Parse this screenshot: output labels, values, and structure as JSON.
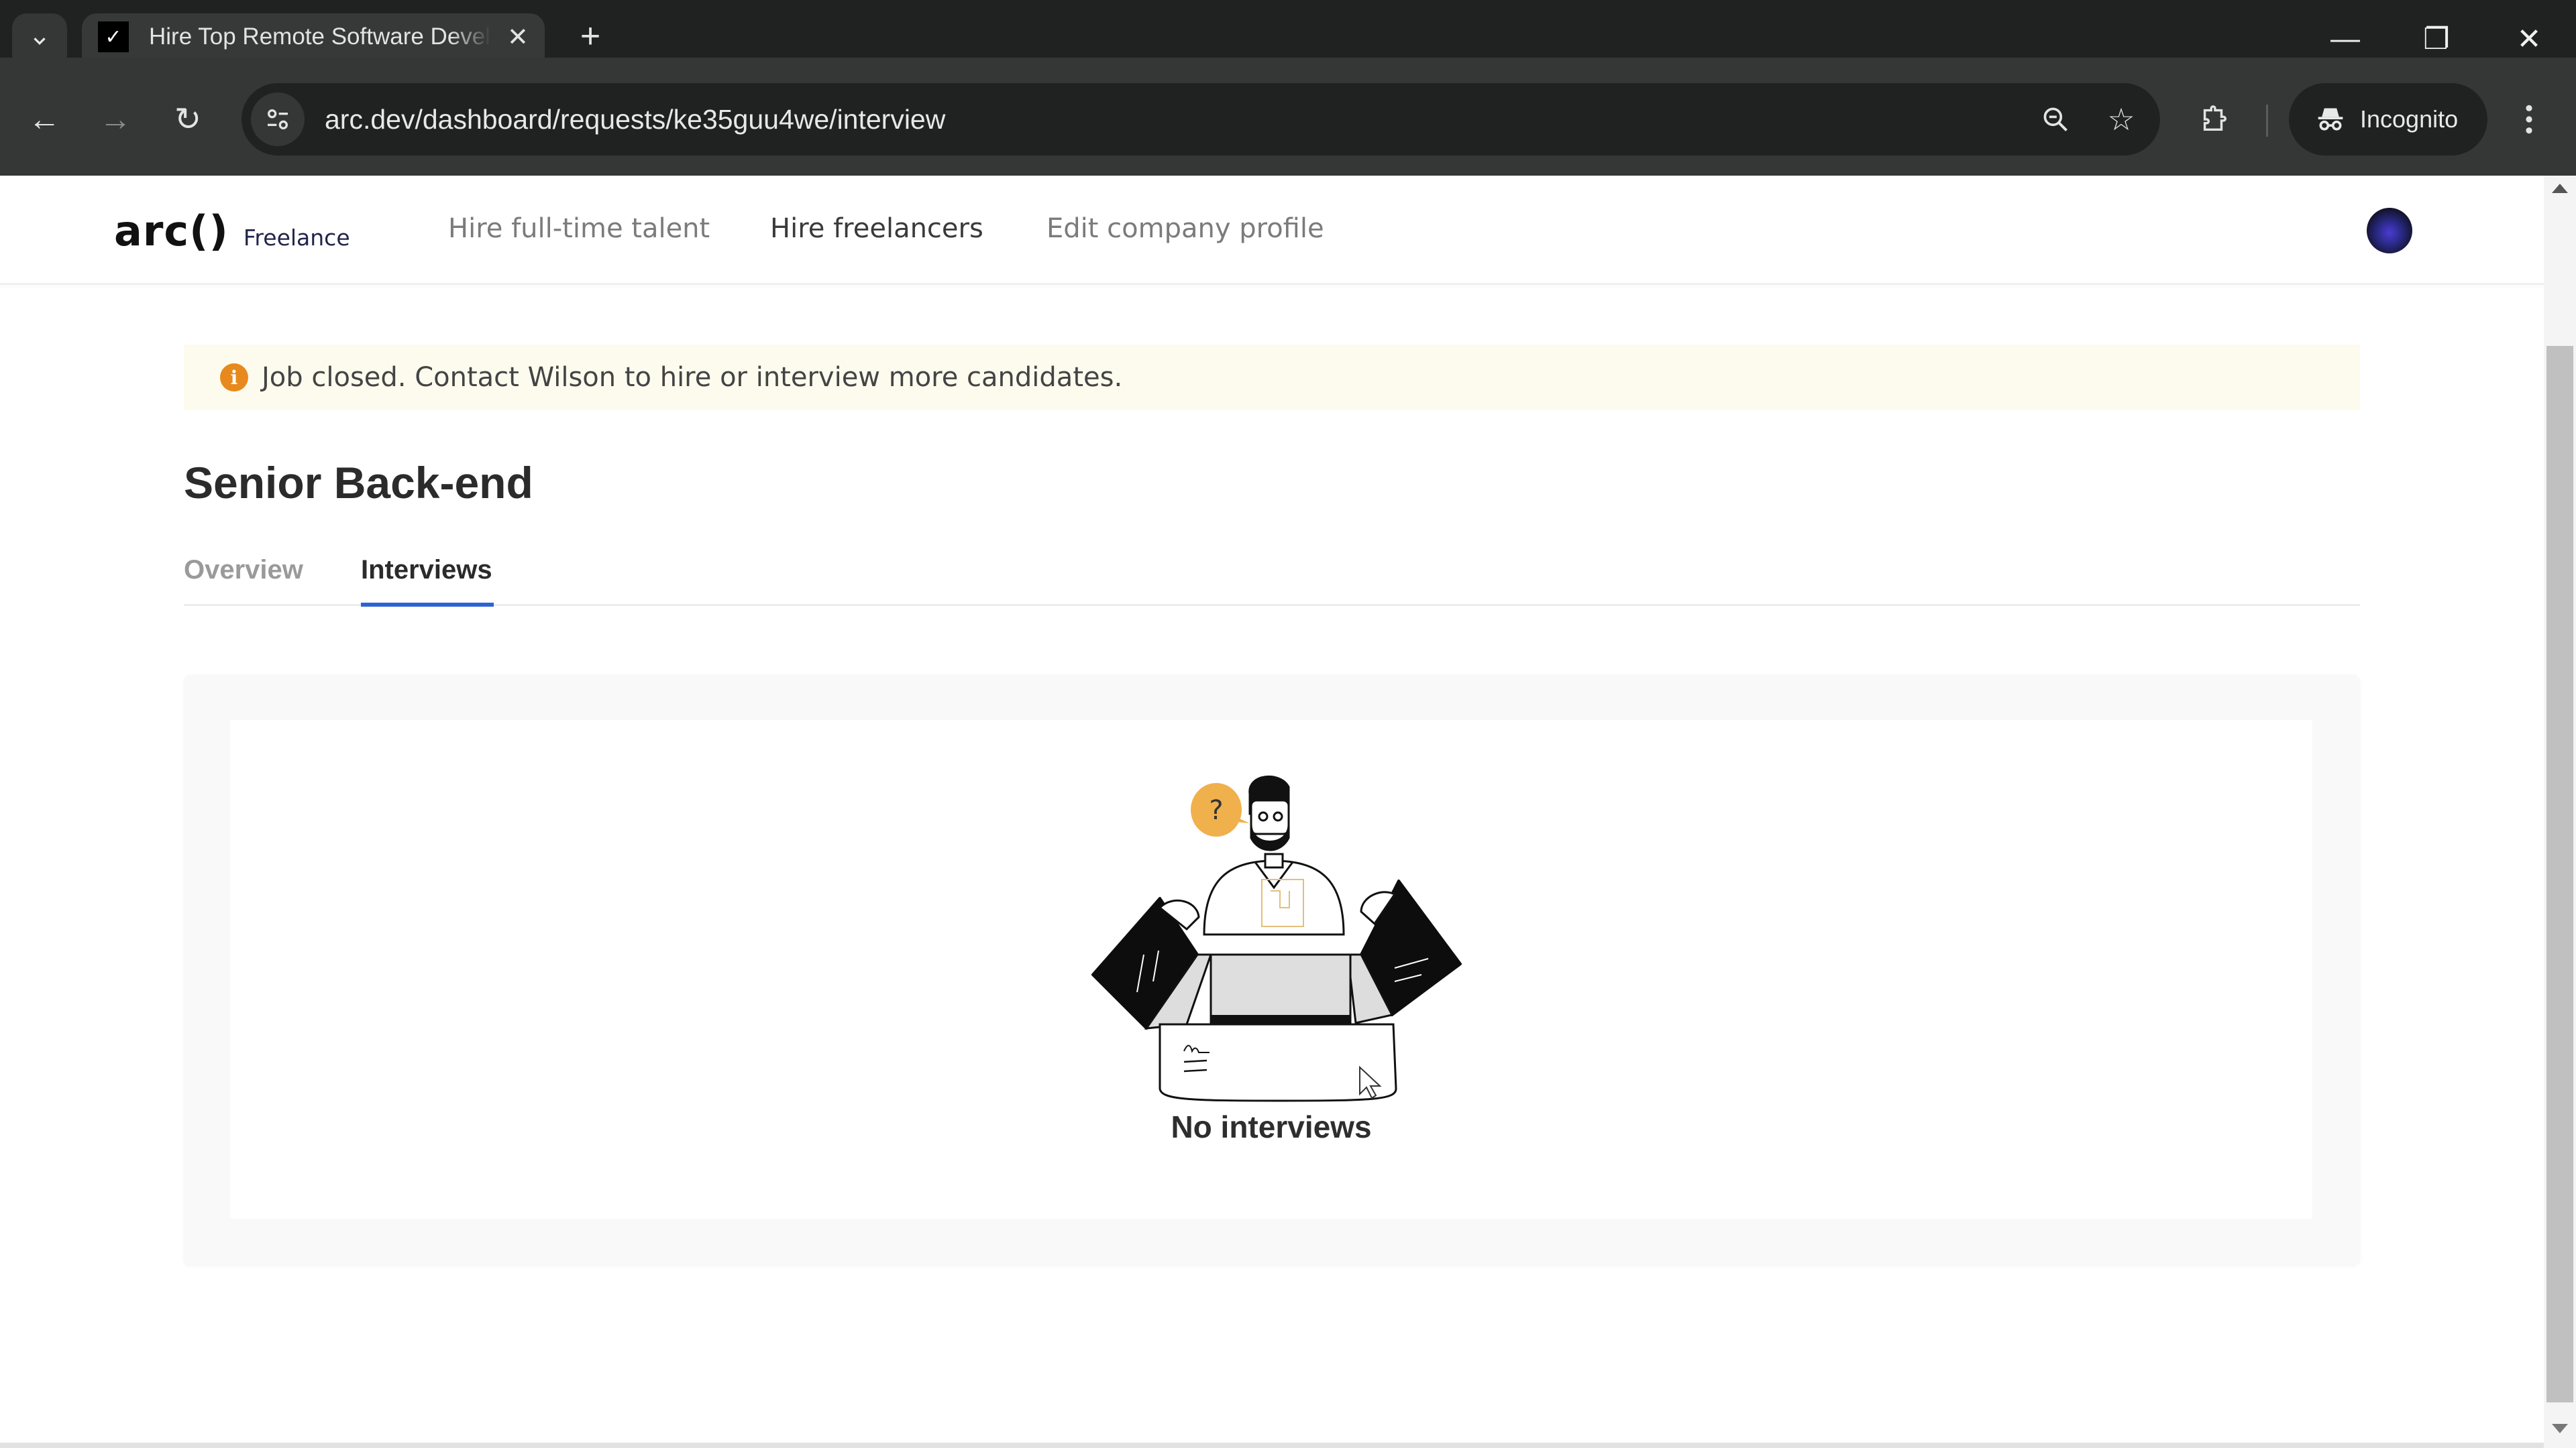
{
  "browser": {
    "tab_title": "Hire Top Remote Software Developers",
    "favicon_glyph": "✓",
    "tab_close_glyph": "✕",
    "new_tab_glyph": "+",
    "tab_list_glyph": "⌄",
    "window_controls": {
      "minimize": "—",
      "restore": "❐",
      "close": "✕"
    },
    "nav": {
      "back": "←",
      "forward": "→",
      "reload": "↻"
    },
    "url": "arc.dev/dashboard/requests/ke35guu4we/interview",
    "zoom_glyph": "⊖",
    "bookmark_glyph": "☆",
    "incognito_label": "Incognito",
    "menu_glyph": "⋮"
  },
  "app": {
    "logo_mark": "arc()",
    "logo_sub": "Freelance",
    "nav": [
      {
        "label": "Hire full-time talent",
        "active": false
      },
      {
        "label": "Hire freelancers",
        "active": true
      },
      {
        "label": "Edit company profile",
        "active": false
      }
    ]
  },
  "banner": {
    "icon_glyph": "i",
    "text": "Job closed. Contact Wilson to hire or interview more candidates.",
    "bg_color": "#fdfbee",
    "icon_color": "#e8891d"
  },
  "job": {
    "title": "Senior Back-end",
    "tabs": [
      {
        "label": "Overview",
        "active": false
      },
      {
        "label": "Interviews",
        "active": true
      }
    ],
    "accent_color": "#2d63d4"
  },
  "empty_state": {
    "illustration": "person-opening-empty-box",
    "question_glyph": "?",
    "title": "No interviews"
  }
}
